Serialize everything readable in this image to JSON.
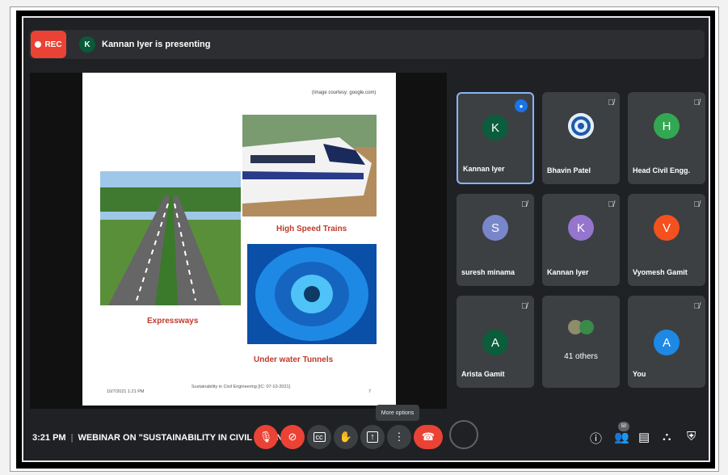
{
  "topbar": {
    "rec_label": "REC",
    "presenter_initial": "K",
    "presenting_text": "Kannan Iyer is presenting"
  },
  "slide": {
    "credit": "(Image courtesy: google.com)",
    "captions": {
      "expressways": "Expressways",
      "trains": "High Speed Trains",
      "tunnels": "Under water Tunnels"
    },
    "footer_date": "10/7/2021 1:21 PM",
    "footer_title": "Sustainability in Civil Engineering [IC: 07-10-2021]",
    "footer_page": "7"
  },
  "participants": [
    {
      "initial": "K",
      "name": "Kannan Iyer",
      "color": "#0b5d3c",
      "speaking": true
    },
    {
      "initial": "",
      "name": "Bhavin Patel",
      "color": "#e8eaed",
      "photo": true
    },
    {
      "initial": "H",
      "name": "Head Civil Engg.",
      "color": "#33a852"
    },
    {
      "initial": "S",
      "name": "suresh minama",
      "color": "#7986cb"
    },
    {
      "initial": "K",
      "name": "Kannan Iyer",
      "color": "#9575cd"
    },
    {
      "initial": "V",
      "name": "Vyomesh Gamit",
      "color": "#f4511e"
    },
    {
      "initial": "A",
      "name": "Arista Gamit",
      "color": "#0b5d3c"
    },
    {
      "initial": "",
      "name": "41 others",
      "color": "#3c4043",
      "others": true
    },
    {
      "initial": "A",
      "name": "You",
      "color": "#1e88e5"
    }
  ],
  "bottom": {
    "time": "3:21 PM",
    "separator": "|",
    "meeting_title": "WEBINAR ON \"SUSTAINABILITY IN CIVIL ENGIN...",
    "tooltip": "More options",
    "people_count": "50"
  }
}
